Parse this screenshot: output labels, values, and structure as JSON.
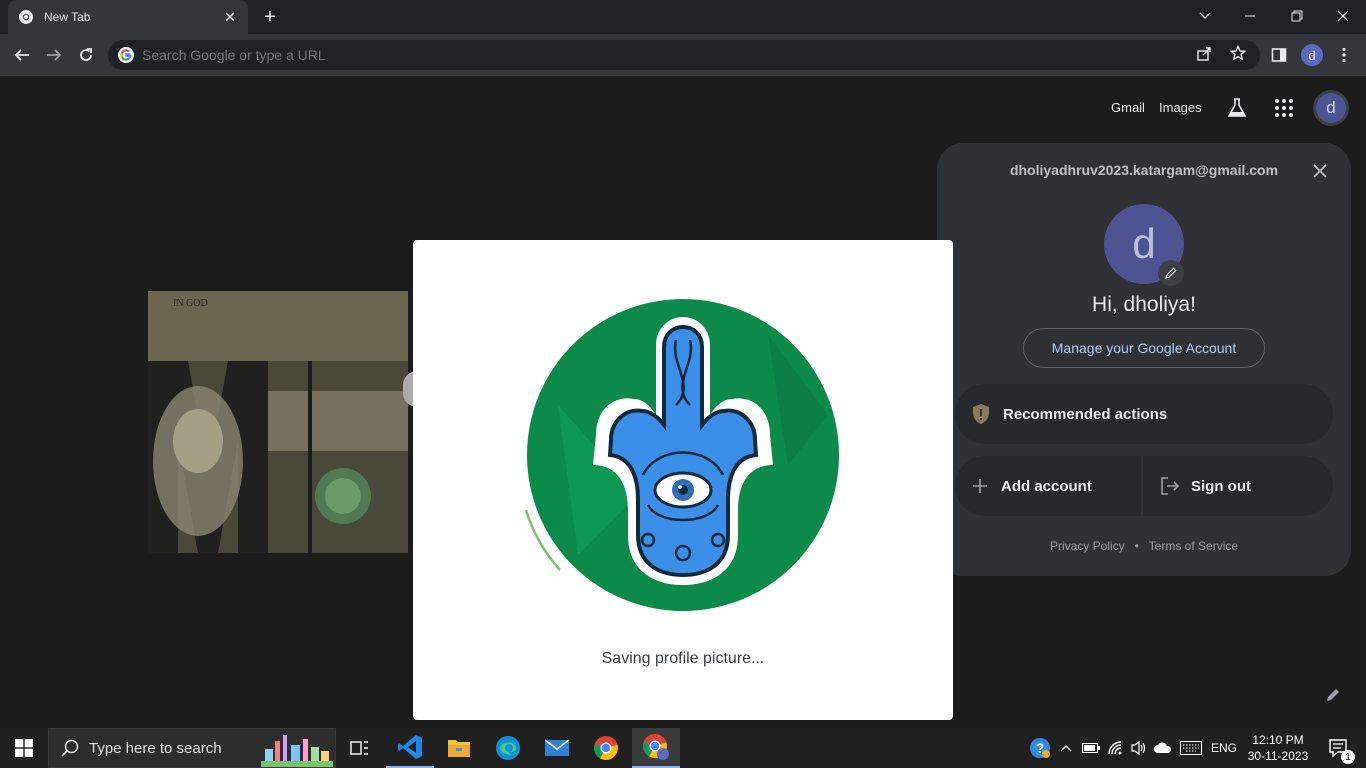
{
  "browser": {
    "tab_title": "New Tab",
    "omnibox_placeholder": "Search Google or type a URL",
    "profile_initial": "d"
  },
  "ntp": {
    "gmail_label": "Gmail",
    "images_label": "Images",
    "profile_initial": "d"
  },
  "account_panel": {
    "email": "dholiyadhruv2023.katargam@gmail.com",
    "avatar_initial": "d",
    "greeting": "Hi, dholiya!",
    "manage_label": "Manage your Google Account",
    "recommended_label": "Recommended actions",
    "add_account_label": "Add account",
    "sign_out_label": "Sign out",
    "privacy_label": "Privacy Policy",
    "separator": "•",
    "terms_label": "Terms of Service"
  },
  "modal": {
    "message": "Saving profile picture..."
  },
  "taskbar": {
    "search_placeholder": "Type here to search",
    "language": "ENG",
    "time": "12:10 PM",
    "date": "30-11-2023",
    "notification_count": "1"
  },
  "colors": {
    "accent_blue": "#aecbfa",
    "panel_bg": "#303134",
    "taskbar_bg": "#202020",
    "hamsa_green": "#0b8a4a",
    "hamsa_blue": "#3b8fe8"
  }
}
